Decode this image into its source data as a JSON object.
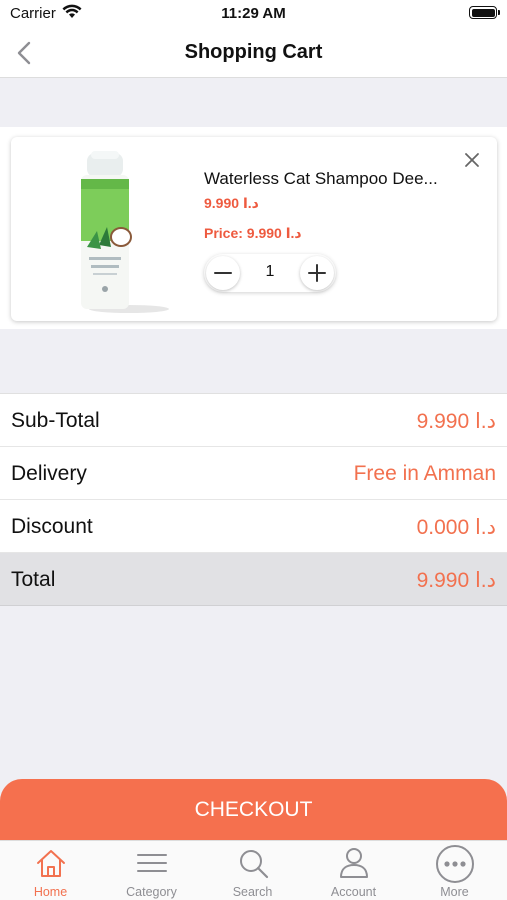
{
  "status_bar": {
    "carrier": "Carrier",
    "time": "11:29 AM"
  },
  "nav": {
    "title": "Shopping Cart",
    "back_icon": "chevron-left-icon"
  },
  "cart_item": {
    "name": "Waterless Cat Shampoo Dee...",
    "price": "9.990 د.ا",
    "price_line": "Price: 9.990 د.ا",
    "quantity": "1",
    "remove_icon": "close-icon",
    "image_label": "Waterless Cat Shampoo"
  },
  "summary": {
    "rows": [
      {
        "label": "Sub-Total",
        "value": "9.990 د.ا"
      },
      {
        "label": "Delivery",
        "value": "Free in Amman"
      },
      {
        "label": "Discount",
        "value": "0.000 د.ا"
      },
      {
        "label": "Total",
        "value": "9.990 د.ا"
      }
    ]
  },
  "checkout": {
    "label": "CHECKOUT"
  },
  "tabs": [
    {
      "label": "Home",
      "icon": "home-icon",
      "active": true
    },
    {
      "label": "Category",
      "icon": "menu-icon",
      "active": false
    },
    {
      "label": "Search",
      "icon": "search-icon",
      "active": false
    },
    {
      "label": "Account",
      "icon": "user-icon",
      "active": false
    },
    {
      "label": "More",
      "icon": "more-icon",
      "active": false
    }
  ],
  "colors": {
    "accent": "#f5704e",
    "price": "#ee5a3f",
    "background": "#efeff4"
  }
}
